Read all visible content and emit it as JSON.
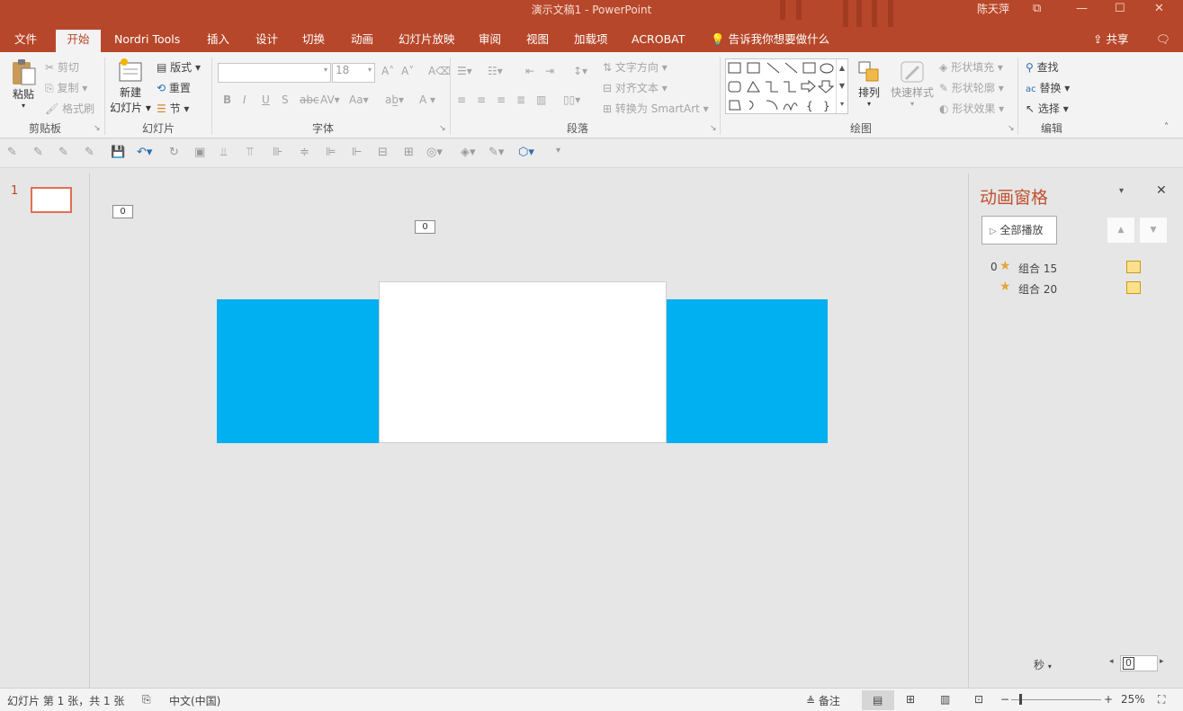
{
  "window": {
    "title": "演示文稿1  -  PowerPoint",
    "user": "陈天萍"
  },
  "tabs": [
    "文件",
    "开始",
    "Nordri Tools",
    "插入",
    "设计",
    "切换",
    "动画",
    "幻灯片放映",
    "审阅",
    "视图",
    "加载项",
    "ACROBAT"
  ],
  "active_tab": "开始",
  "tell_me": "告诉我你想要做什么",
  "share": "共享",
  "ribbon": {
    "clipboard": {
      "paste": "粘贴",
      "cut": "剪切",
      "copy": "复制",
      "format_painter": "格式刷",
      "label": "剪贴板"
    },
    "slides": {
      "new_slide_line1": "新建",
      "new_slide_line2": "幻灯片",
      "layout": "版式",
      "reset": "重置",
      "section": "节",
      "label": "幻灯片"
    },
    "font": {
      "font_name": "",
      "font_size": "18",
      "label": "字体"
    },
    "paragraph": {
      "text_direction": "文字方向",
      "align_text": "对齐文本",
      "convert_smartart": "转换为 SmartArt",
      "label": "段落"
    },
    "drawing": {
      "arrange": "排列",
      "quick_styles": "快速样式",
      "shape_fill": "形状填充",
      "shape_outline": "形状轮廓",
      "shape_effects": "形状效果",
      "label": "绘图"
    },
    "editing": {
      "find": "查找",
      "replace": "替换",
      "select": "选择",
      "label": "编辑"
    }
  },
  "thumbnails": [
    {
      "number": "1"
    }
  ],
  "slide": {
    "tag_a": "0",
    "tag_b": "0",
    "colors": {
      "blue": "#00b0f0",
      "white": "#ffffff"
    }
  },
  "animation_pane": {
    "title": "动画窗格",
    "play_all": "全部播放",
    "items": [
      {
        "index": "0",
        "name": "组合 15"
      },
      {
        "index": "",
        "name": "组合 20"
      }
    ],
    "seconds": "秒",
    "timeline_value": "0"
  },
  "status": {
    "slide_info": "幻灯片 第 1 张，共 1 张",
    "language": "中文(中国)",
    "notes": "备注",
    "zoom": "25%"
  },
  "colors": {
    "accent": "#b7472a",
    "star": "#e8a33a",
    "timing_box": "#ffe08a"
  }
}
